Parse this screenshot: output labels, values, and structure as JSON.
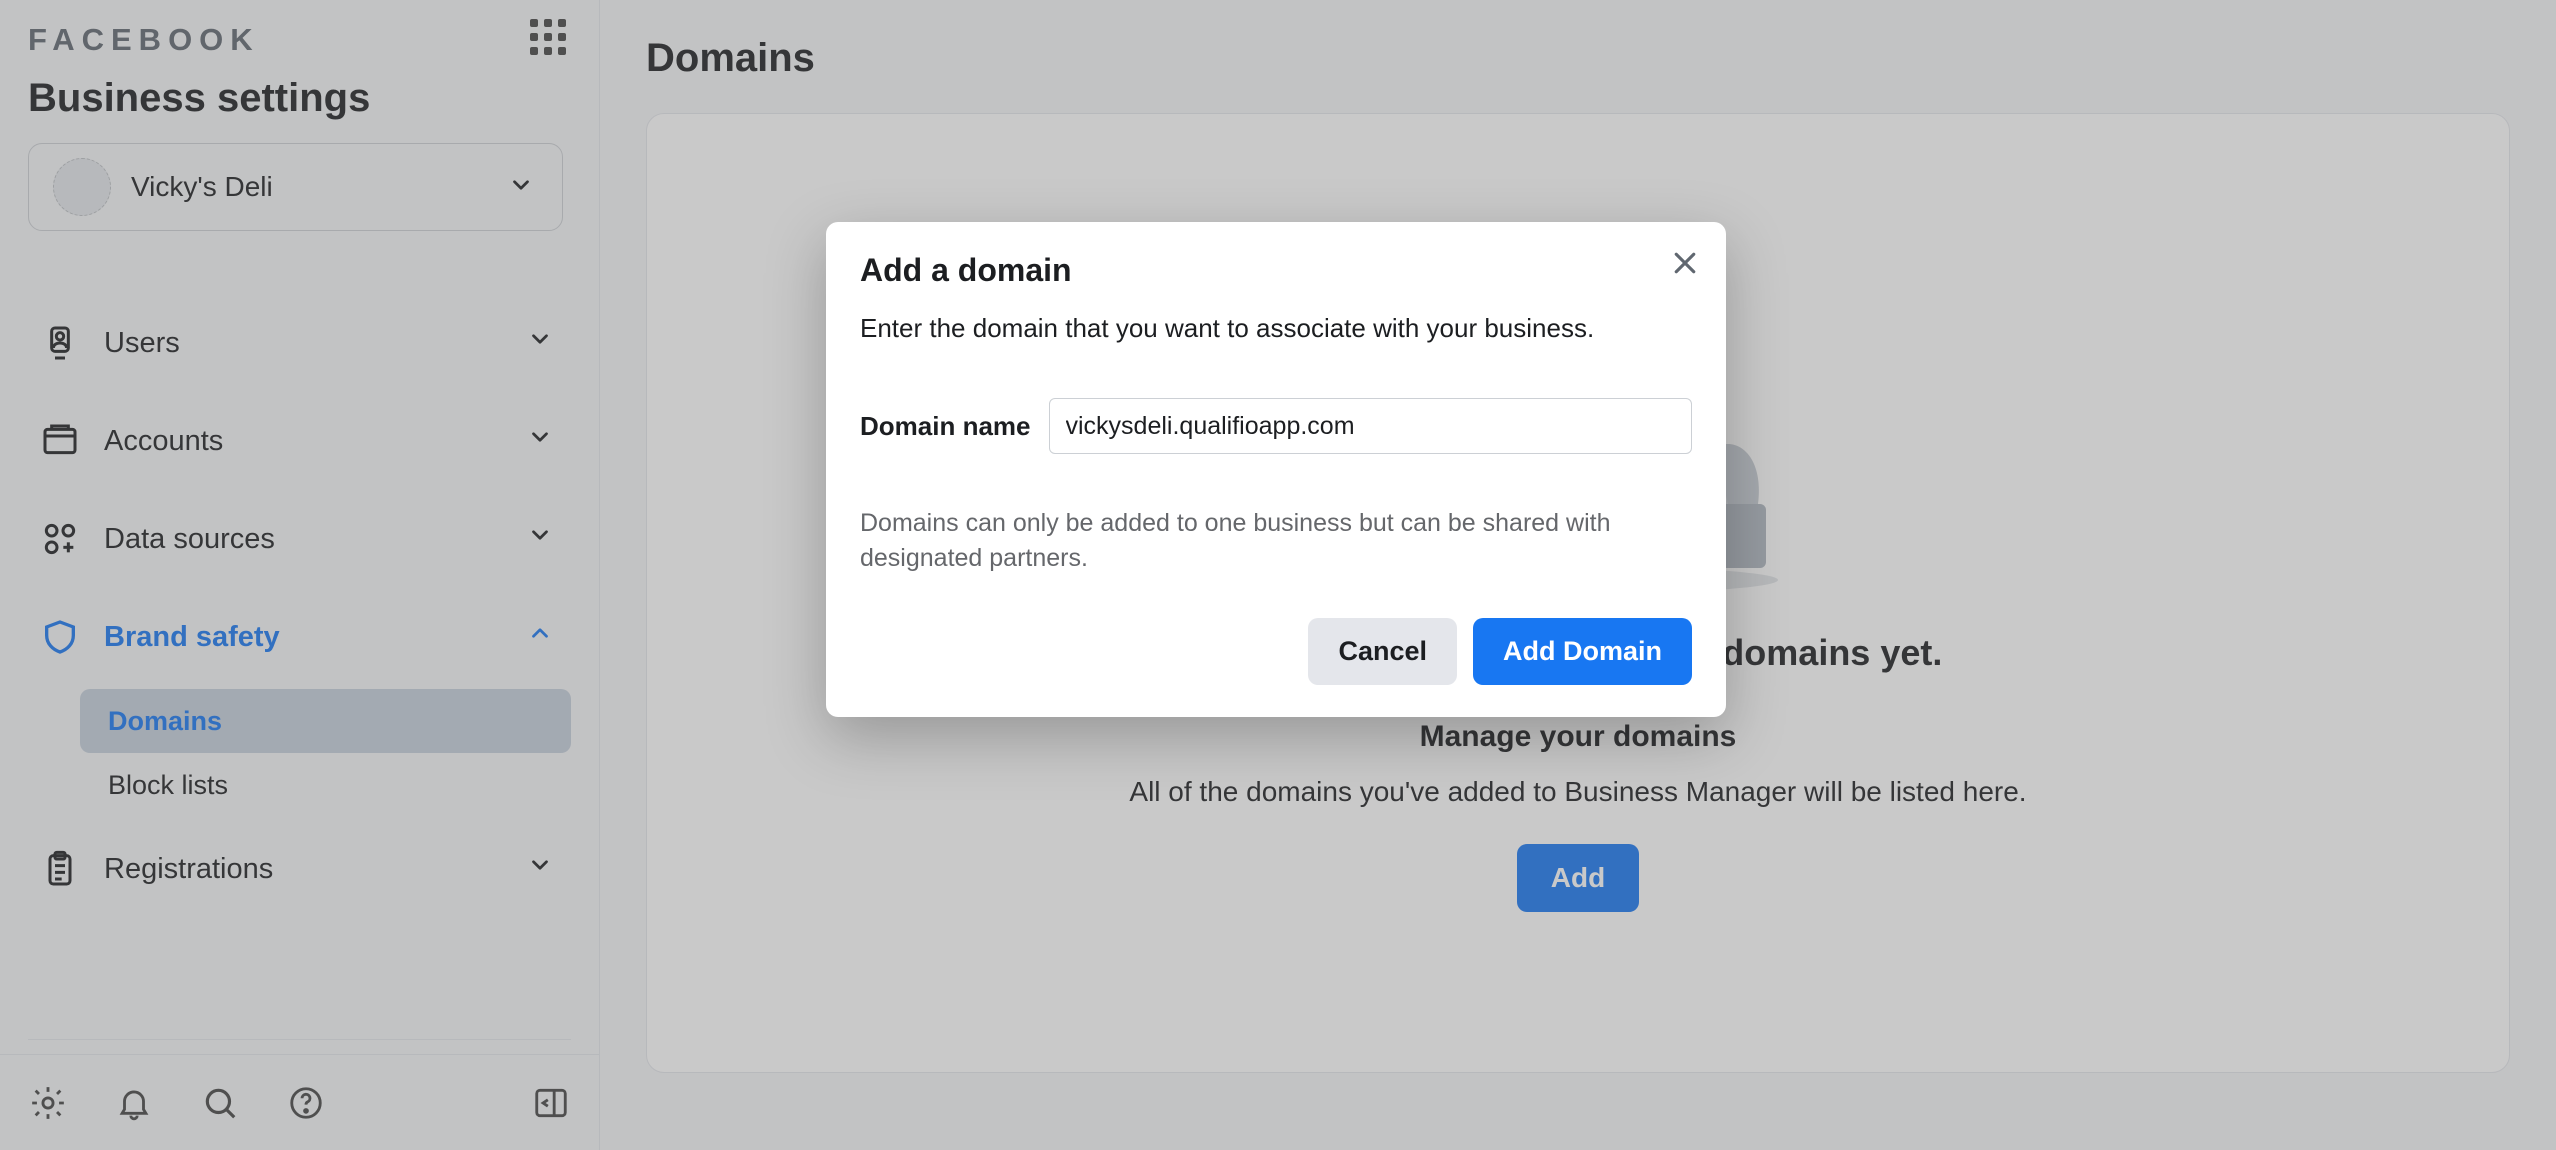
{
  "brand": "FACEBOOK",
  "page_title": "Business settings",
  "business_name": "Vicky's Deli",
  "nav": {
    "users": "Users",
    "accounts": "Accounts",
    "data_sources": "Data sources",
    "brand_safety": "Brand safety",
    "domains": "Domains",
    "block_lists": "Block lists",
    "registrations": "Registrations"
  },
  "main": {
    "title": "Domains",
    "empty_title": "Vicky's Deli doesn't have any domains yet.",
    "empty_subtitle": "Manage your domains",
    "empty_desc": "All of the domains you've added to Business Manager will be listed here.",
    "add_label": "Add"
  },
  "modal": {
    "title": "Add a domain",
    "desc": "Enter the domain that you want to associate with your business.",
    "field_label": "Domain name",
    "domain_value": "vickysdeli.qualifioapp.com",
    "note": "Domains can only be added to one business but can be shared with designated partners.",
    "cancel": "Cancel",
    "submit": "Add Domain"
  }
}
